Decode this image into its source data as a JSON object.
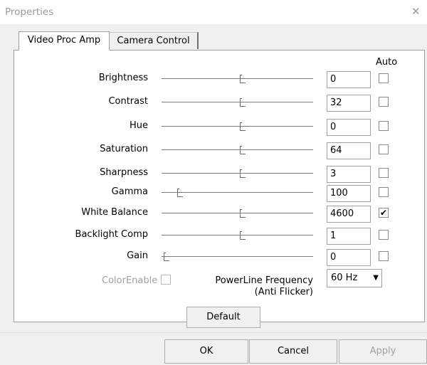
{
  "window": {
    "title": "Properties",
    "close_glyph": "✕"
  },
  "tabs": [
    {
      "label": "Video Proc Amp",
      "active": true
    },
    {
      "label": "Camera Control",
      "active": false
    }
  ],
  "auto_header": "Auto",
  "controls": [
    {
      "label": "Brightness",
      "value": "0",
      "slider_fraction": 0.5,
      "auto": false
    },
    {
      "label": "Contrast",
      "value": "32",
      "slider_fraction": 0.5,
      "auto": false
    },
    {
      "label": "Hue",
      "value": "0",
      "slider_fraction": 0.5,
      "auto": false
    },
    {
      "label": "Saturation",
      "value": "64",
      "slider_fraction": 0.5,
      "auto": false
    },
    {
      "label": "Sharpness",
      "value": "3",
      "slider_fraction": 0.5,
      "auto": false
    },
    {
      "label": "Gamma",
      "value": "100",
      "slider_fraction": 0.09,
      "auto": false
    },
    {
      "label": "White Balance",
      "value": "4600",
      "slider_fraction": 0.5,
      "auto": true
    },
    {
      "label": "Backlight Comp",
      "value": "1",
      "slider_fraction": 0.5,
      "auto": false
    },
    {
      "label": "Gain",
      "value": "0",
      "slider_fraction": 0.0,
      "auto": false
    }
  ],
  "color_enable": {
    "label": "ColorEnable",
    "checked": false,
    "disabled": true
  },
  "powerline": {
    "label_line1": "PowerLine Frequency",
    "label_line2": "(Anti Flicker)",
    "selected": "60 Hz",
    "arrow_glyph": "▼"
  },
  "buttons": {
    "default": "Default",
    "ok": "OK",
    "cancel": "Cancel",
    "apply": "Apply"
  },
  "check_glyph": "✔"
}
